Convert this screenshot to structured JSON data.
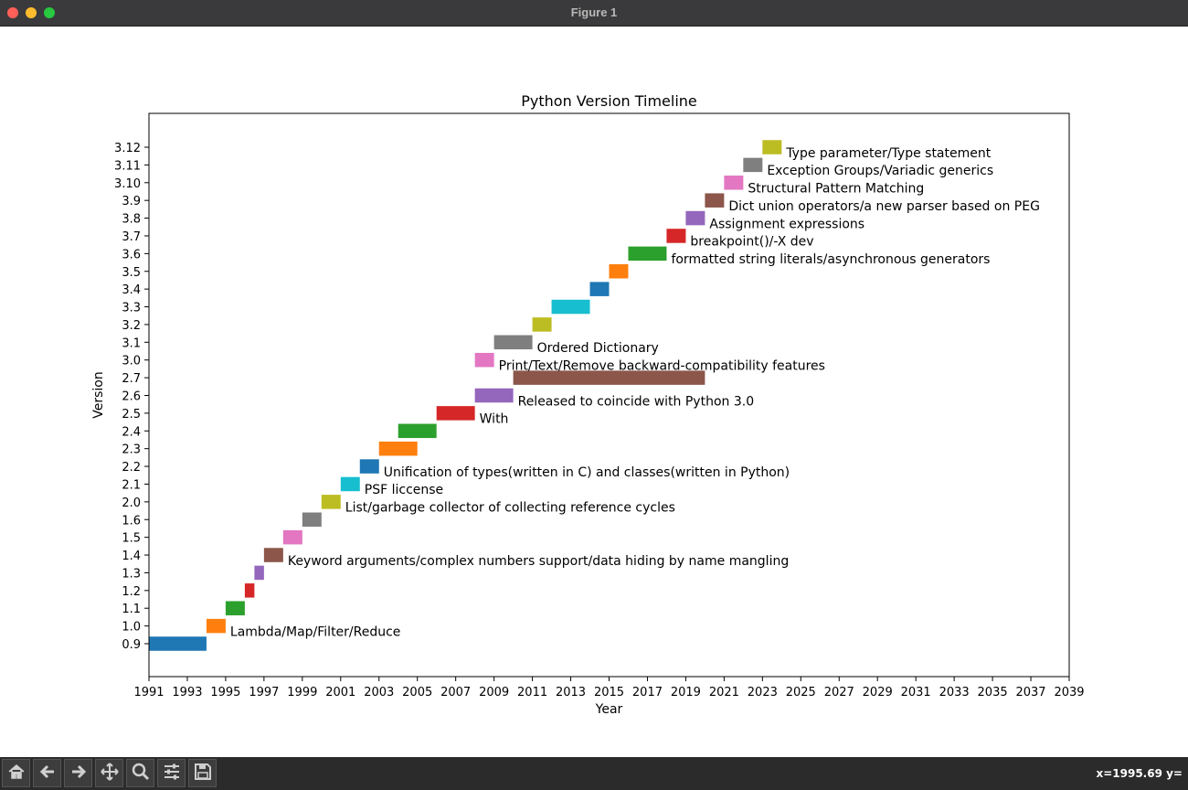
{
  "window": {
    "title": "Figure 1",
    "buttons": [
      {
        "name": "close",
        "color": "#ff5f57"
      },
      {
        "name": "minimize",
        "color": "#febc2e"
      },
      {
        "name": "zoom",
        "color": "#28c840"
      }
    ]
  },
  "toolbar": {
    "buttons": [
      "home-icon",
      "back-icon",
      "forward-icon",
      "pan-icon",
      "zoom-icon",
      "configure-subplots-icon",
      "save-icon"
    ],
    "coordinate_readout": "x=1995.69 y="
  },
  "chart_data": {
    "type": "bar",
    "orientation": "horizontal",
    "title": "Python Version Timeline",
    "xlabel": "Year",
    "ylabel": "Version",
    "xlim": [
      1991,
      2039
    ],
    "x_ticks": [
      1991,
      1993,
      1995,
      1997,
      1999,
      2001,
      2003,
      2005,
      2007,
      2009,
      2011,
      2013,
      2015,
      2017,
      2019,
      2021,
      2023,
      2025,
      2027,
      2029,
      2031,
      2033,
      2035,
      2037,
      2039
    ],
    "categories": [
      "0.9",
      "1.0",
      "1.1",
      "1.2",
      "1.3",
      "1.4",
      "1.5",
      "1.6",
      "2.0",
      "2.1",
      "2.2",
      "2.3",
      "2.4",
      "2.5",
      "2.6",
      "2.7",
      "3.0",
      "3.1",
      "3.2",
      "3.3",
      "3.4",
      "3.5",
      "3.6",
      "3.7",
      "3.8",
      "3.9",
      "3.10",
      "3.11",
      "3.12"
    ],
    "bars": [
      {
        "version": "0.9",
        "start": 1991,
        "end": 1994,
        "color": "#1f77b4",
        "label": ""
      },
      {
        "version": "1.0",
        "start": 1994,
        "end": 1995,
        "color": "#ff7f0e",
        "label": "Lambda/Map/Filter/Reduce"
      },
      {
        "version": "1.1",
        "start": 1995,
        "end": 1996,
        "color": "#2ca02c",
        "label": ""
      },
      {
        "version": "1.2",
        "start": 1996,
        "end": 1996.5,
        "color": "#d62728",
        "label": ""
      },
      {
        "version": "1.3",
        "start": 1996.5,
        "end": 1997,
        "color": "#9467bd",
        "label": ""
      },
      {
        "version": "1.4",
        "start": 1997,
        "end": 1998,
        "color": "#8c564b",
        "label": "Keyword arguments/complex numbers support/data hiding by name mangling"
      },
      {
        "version": "1.5",
        "start": 1998,
        "end": 1999,
        "color": "#e377c2",
        "label": ""
      },
      {
        "version": "1.6",
        "start": 1999,
        "end": 2000,
        "color": "#7f7f7f",
        "label": ""
      },
      {
        "version": "2.0",
        "start": 2000,
        "end": 2001,
        "color": "#bcbd22",
        "label": "List/garbage collector of collecting reference cycles"
      },
      {
        "version": "2.1",
        "start": 2001,
        "end": 2002,
        "color": "#17becf",
        "label": "PSF liccense"
      },
      {
        "version": "2.2",
        "start": 2002,
        "end": 2003,
        "color": "#1f77b4",
        "label": "Unification of types(written in C) and classes(written in Python)"
      },
      {
        "version": "2.3",
        "start": 2003,
        "end": 2005,
        "color": "#ff7f0e",
        "label": ""
      },
      {
        "version": "2.4",
        "start": 2004,
        "end": 2006,
        "color": "#2ca02c",
        "label": ""
      },
      {
        "version": "2.5",
        "start": 2006,
        "end": 2008,
        "color": "#d62728",
        "label": "With"
      },
      {
        "version": "2.6",
        "start": 2008,
        "end": 2010,
        "color": "#9467bd",
        "label": "Released to coincide with Python 3.0"
      },
      {
        "version": "2.7",
        "start": 2010,
        "end": 2020,
        "color": "#8c564b",
        "label": ""
      },
      {
        "version": "3.0",
        "start": 2008,
        "end": 2009,
        "color": "#e377c2",
        "label": "Print/Text/Remove backward-compatibility features"
      },
      {
        "version": "3.1",
        "start": 2009,
        "end": 2011,
        "color": "#7f7f7f",
        "label": "Ordered Dictionary"
      },
      {
        "version": "3.2",
        "start": 2011,
        "end": 2012,
        "color": "#bcbd22",
        "label": ""
      },
      {
        "version": "3.3",
        "start": 2012,
        "end": 2014,
        "color": "#17becf",
        "label": ""
      },
      {
        "version": "3.4",
        "start": 2014,
        "end": 2015,
        "color": "#1f77b4",
        "label": ""
      },
      {
        "version": "3.5",
        "start": 2015,
        "end": 2016,
        "color": "#ff7f0e",
        "label": ""
      },
      {
        "version": "3.6",
        "start": 2016,
        "end": 2018,
        "color": "#2ca02c",
        "label": "formatted string literals/asynchronous generators"
      },
      {
        "version": "3.7",
        "start": 2018,
        "end": 2019,
        "color": "#d62728",
        "label": "breakpoint()/-X dev"
      },
      {
        "version": "3.8",
        "start": 2019,
        "end": 2020,
        "color": "#9467bd",
        "label": "Assignment expressions"
      },
      {
        "version": "3.9",
        "start": 2020,
        "end": 2021,
        "color": "#8c564b",
        "label": "Dict union operators/a new parser based on PEG"
      },
      {
        "version": "3.10",
        "start": 2021,
        "end": 2022,
        "color": "#e377c2",
        "label": "Structural Pattern Matching"
      },
      {
        "version": "3.11",
        "start": 2022,
        "end": 2023,
        "color": "#7f7f7f",
        "label": "Exception Groups/Variadic generics"
      },
      {
        "version": "3.12",
        "start": 2023,
        "end": 2024,
        "color": "#bcbd22",
        "label": "Type parameter/Type statement"
      }
    ],
    "grid": false,
    "legend": "none"
  }
}
